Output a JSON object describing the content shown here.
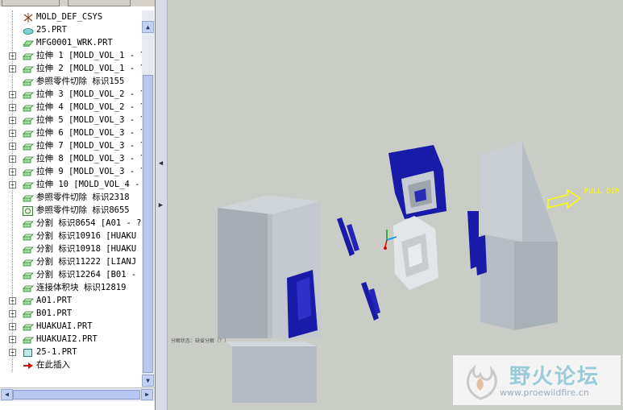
{
  "tree": {
    "items": [
      {
        "label": "MOLD_DEF_CSYS",
        "expandable": false,
        "icon": "csys-icon"
      },
      {
        "label": "25.PRT",
        "expandable": false,
        "icon": "part-icon"
      },
      {
        "label": "MFG0001_WRK.PRT",
        "expandable": false,
        "icon": "workpiece-icon"
      },
      {
        "label": "拉伸 1 [MOLD_VOL_1 - ?",
        "expandable": true,
        "icon": "extrude-icon"
      },
      {
        "label": "拉伸 2 [MOLD_VOL_1 - ?",
        "expandable": true,
        "icon": "extrude-icon"
      },
      {
        "label": "参照零件切除 标识155",
        "expandable": false,
        "icon": "extrude-icon"
      },
      {
        "label": "拉伸 3 [MOLD_VOL_2 - ?",
        "expandable": true,
        "icon": "extrude-icon"
      },
      {
        "label": "拉伸 4 [MOLD_VOL_2 - ?",
        "expandable": true,
        "icon": "extrude-icon"
      },
      {
        "label": "拉伸 5 [MOLD_VOL_3 - ?",
        "expandable": true,
        "icon": "extrude-icon"
      },
      {
        "label": "拉伸 6 [MOLD_VOL_3 - ?",
        "expandable": true,
        "icon": "extrude-icon"
      },
      {
        "label": "拉伸 7 [MOLD_VOL_3 - ?",
        "expandable": true,
        "icon": "extrude-icon"
      },
      {
        "label": "拉伸 8 [MOLD_VOL_3 - ?",
        "expandable": true,
        "icon": "extrude-icon"
      },
      {
        "label": "拉伸 9 [MOLD_VOL_3 - ?",
        "expandable": true,
        "icon": "extrude-icon"
      },
      {
        "label": "拉伸 10 [MOLD_VOL_4 - ",
        "expandable": true,
        "icon": "extrude-icon"
      },
      {
        "label": "参照零件切除 标识2318",
        "expandable": false,
        "icon": "extrude-icon"
      },
      {
        "label": "参照零件切除 标识8655",
        "expandable": false,
        "icon": "refcut-icon"
      },
      {
        "label": "分割 标识8654 [A01 - ?",
        "expandable": false,
        "icon": "extrude-icon"
      },
      {
        "label": "分割 标识10916 [HUAKU",
        "expandable": false,
        "icon": "extrude-icon"
      },
      {
        "label": "分割 标识10918 [HUAKU",
        "expandable": false,
        "icon": "extrude-icon"
      },
      {
        "label": "分割 标识11222 [LIANJ",
        "expandable": false,
        "icon": "extrude-icon"
      },
      {
        "label": "分割 标识12264 [B01 - ",
        "expandable": false,
        "icon": "extrude-icon"
      },
      {
        "label": "连接体积块 标识12819",
        "expandable": false,
        "icon": "extrude-icon"
      },
      {
        "label": "A01.PRT",
        "expandable": true,
        "icon": "extrude-icon"
      },
      {
        "label": "B01.PRT",
        "expandable": true,
        "icon": "extrude-icon"
      },
      {
        "label": "HUAKUAI.PRT",
        "expandable": true,
        "icon": "extrude-icon"
      },
      {
        "label": "HUAKUAI2.PRT",
        "expandable": true,
        "icon": "extrude-icon"
      },
      {
        "label": "25-1.PRT",
        "expandable": true,
        "icon": "cube-icon"
      },
      {
        "label": "在此插入",
        "expandable": false,
        "icon": "insert-arrow-icon"
      }
    ]
  },
  "viewport": {
    "pull_direction_label": "PULL DIR",
    "status_note": "分解状态：缺省分解（？）"
  },
  "watermark": {
    "title": "野火论坛",
    "url": "www.proewildfire.cn"
  },
  "colors": {
    "background": "#c9cdc6",
    "mold_block": "#b5bcc3",
    "mold_accent": "#1a1aa8",
    "pull_arrow": "#ffff00"
  }
}
